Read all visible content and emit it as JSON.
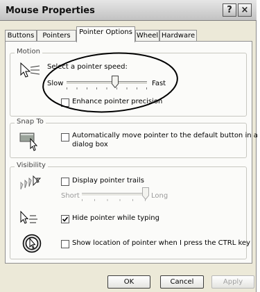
{
  "window": {
    "title": "Mouse Properties",
    "help_button": "?",
    "close_button": "×"
  },
  "tabs": [
    "Buttons",
    "Pointers",
    "Pointer Options",
    "Wheel",
    "Hardware"
  ],
  "motion": {
    "group_label": "Motion",
    "speed_label": "Select a pointer speed:",
    "slow": "Slow",
    "fast": "Fast",
    "speed_level": 0.6,
    "enhance_label": "Enhance pointer precision",
    "enhance_checked": false
  },
  "snap_to": {
    "group_label": "Snap To",
    "auto_label_line1": "Automatically move pointer to the default button in a",
    "auto_label_line2": "dialog box",
    "auto_checked": false
  },
  "visibility": {
    "group_label": "Visibility",
    "trails_label": "Display pointer trails",
    "trails_checked": false,
    "short": "Short",
    "long": "Long",
    "trails_level": 1.0,
    "hide_label": "Hide pointer while typing",
    "hide_checked": true,
    "ctrl_label": "Show location of pointer when I press the CTRL key",
    "ctrl_checked": false
  },
  "buttons": {
    "ok": "OK",
    "cancel": "Cancel",
    "apply": "Apply"
  },
  "icons": [
    "help-icon",
    "close-icon",
    "pointer-speed-icon",
    "snap-to-icon",
    "pointer-trails-icon",
    "hide-pointer-icon",
    "ctrl-location-icon",
    "checkmark-icon"
  ],
  "colors": {
    "dialog_bg": "#ece9d8",
    "panel_bg": "#fbfbf9",
    "annotation_ellipse": "#000000"
  }
}
